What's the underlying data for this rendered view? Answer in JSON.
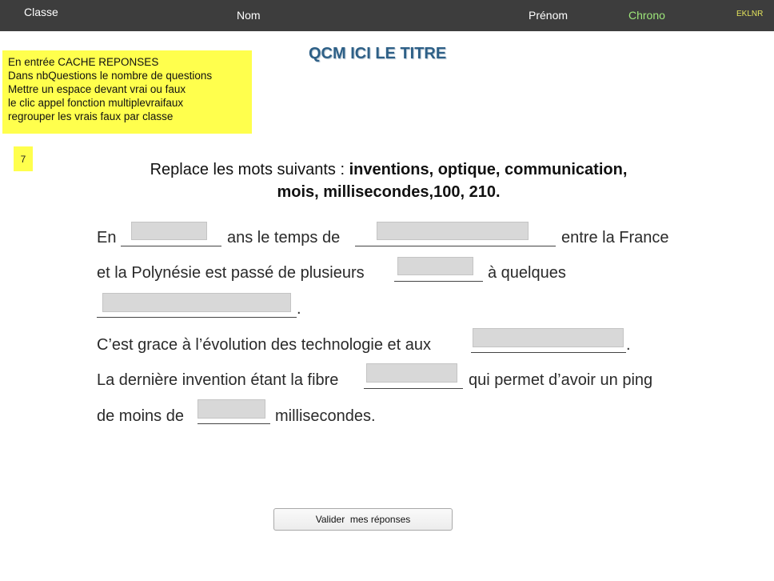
{
  "header": {
    "classe_label": "Classe",
    "nom_label": "Nom",
    "prenom_label": "Prénom",
    "chrono_label": "Chrono",
    "code": "EKLNR"
  },
  "title": "QCM ICI LE TITRE",
  "note": {
    "lines": [
      "En entrée CACHE REPONSES",
      "Dans nbQuestions le nombre de questions",
      "Mettre un espace devant vrai ou faux",
      "le clic appel fonction multiplevraifaux",
      "regrouper les vrais faux par classe"
    ]
  },
  "question_number": "7",
  "instruction": {
    "prefix": "Replace les mots suivants : ",
    "words_line1": "inventions, optique, communication,",
    "words_line2": "mois, millisecondes,100, 210."
  },
  "text": {
    "s1_a": "En",
    "s1_b": "ans le temps de",
    "s1_c": "entre la France",
    "s2_a": "et la Polynésie est passé de plusieurs",
    "s2_b": "à quelques",
    "s3_end": ".",
    "s4_a": "C’est grace à l’évolution des technologie et aux",
    "s4_end": ".",
    "s5_a": "La dernière invention étant la fibre",
    "s5_b": "qui permet d’avoir un ping",
    "s6_a": "de moins de",
    "s6_b": "millisecondes."
  },
  "inputs": {
    "blank1": "",
    "blank2": "",
    "blank3": "",
    "blank4": "",
    "blank5": "",
    "blank6": "",
    "blank7": ""
  },
  "colors": {
    "topbar": "#3d3d3d",
    "chrono": "#9ee77a",
    "code": "#e3e35c",
    "note_bg": "#ffff4d",
    "title": "#2d5f86"
  },
  "submit_label": "Valider  mes réponses"
}
